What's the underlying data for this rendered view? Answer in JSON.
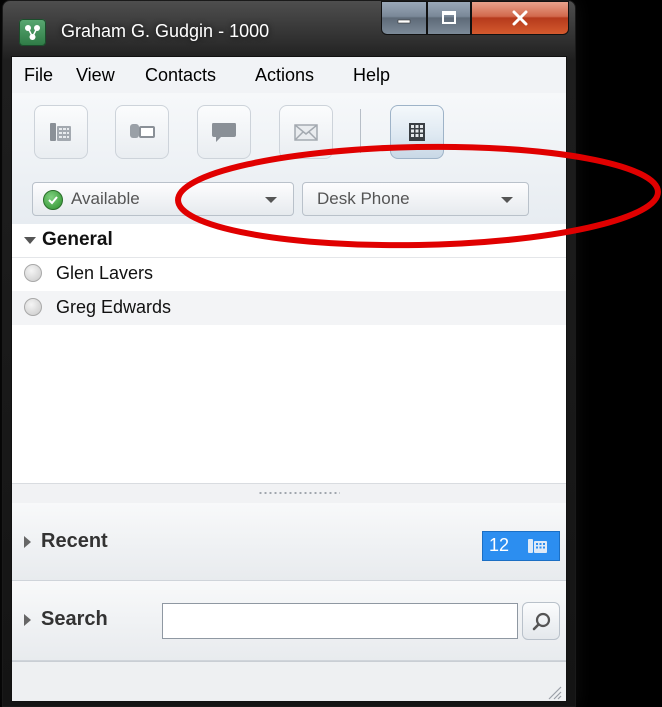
{
  "window": {
    "title": "Graham G. Gudgin - 1000",
    "icon": "app-logo-icon"
  },
  "controls": {
    "minimize_icon": "minimize-icon",
    "maximize_icon": "maximize-icon",
    "close_icon": "close-icon"
  },
  "menubar": {
    "items": [
      {
        "label": "File"
      },
      {
        "label": "View"
      },
      {
        "label": "Contacts"
      },
      {
        "label": "Actions"
      },
      {
        "label": "Help"
      }
    ]
  },
  "toolbar": {
    "buttons": [
      {
        "icon": "phone-icon"
      },
      {
        "icon": "video-icon"
      },
      {
        "icon": "chat-icon"
      },
      {
        "icon": "mail-icon"
      },
      {
        "icon": "dialpad-icon"
      }
    ],
    "status": {
      "label": "Available",
      "icon": "check-icon"
    },
    "device": {
      "label": "Desk Phone"
    }
  },
  "contacts": {
    "group": "General",
    "items": [
      {
        "name": "Glen Lavers"
      },
      {
        "name": "Greg Edwards"
      }
    ]
  },
  "recent": {
    "label": "Recent",
    "count": "12",
    "badge_color": "#2c8ef0"
  },
  "search": {
    "label": "Search",
    "value": "",
    "icon": "search-icon"
  },
  "colors": {
    "annotation": "#e00000",
    "accent": "#2c8ef0"
  }
}
